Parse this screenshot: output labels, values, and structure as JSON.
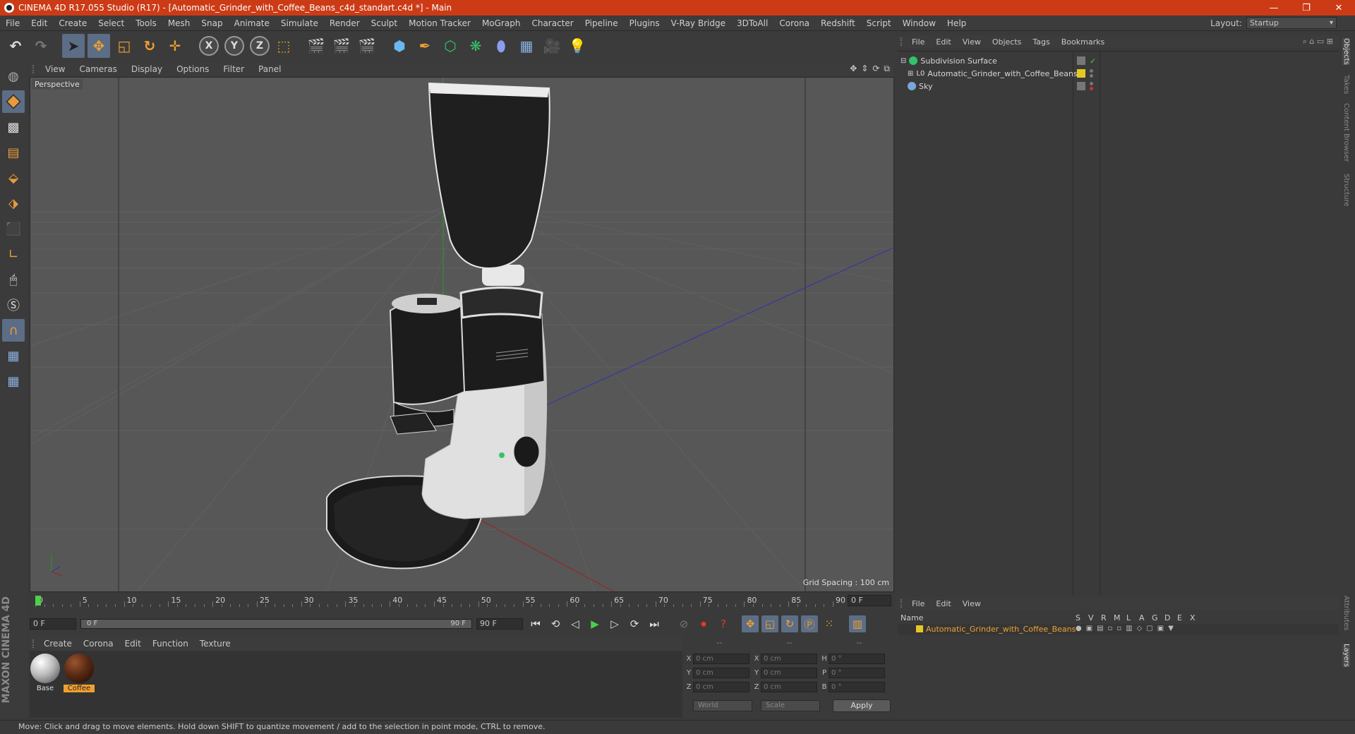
{
  "window": {
    "title": "CINEMA 4D R17.055 Studio (R17) - [Automatic_Grinder_with_Coffee_Beans_c4d_standart.c4d *] - Main",
    "controls": [
      "—",
      "❐",
      "✕"
    ]
  },
  "menubar": {
    "items": [
      "File",
      "Edit",
      "Create",
      "Select",
      "Tools",
      "Mesh",
      "Snap",
      "Animate",
      "Simulate",
      "Render",
      "Sculpt",
      "Motion Tracker",
      "MoGraph",
      "Character",
      "Pipeline",
      "Plugins",
      "V-Ray Bridge",
      "3DToAll",
      "Corona",
      "Redshift",
      "Script",
      "Window",
      "Help"
    ],
    "layout_label": "Layout:",
    "layout_value": "Startup"
  },
  "toolbar": {
    "axis_x": "X",
    "axis_y": "Y",
    "axis_z": "Z"
  },
  "viewport": {
    "menu": [
      "View",
      "Cameras",
      "Display",
      "Options",
      "Filter",
      "Panel"
    ],
    "label": "Perspective",
    "grid_spacing": "Grid Spacing : 100 cm"
  },
  "timeline": {
    "ticks": [
      "0",
      "5",
      "10",
      "15",
      "20",
      "25",
      "30",
      "35",
      "40",
      "45",
      "50",
      "55",
      "60",
      "65",
      "70",
      "75",
      "80",
      "85",
      "90"
    ],
    "current_frame": "0 F",
    "start_field": "0 F",
    "range_start": "0 F",
    "range_end": "90 F",
    "end_field": "90 F"
  },
  "material_manager": {
    "menu": [
      "Create",
      "Corona",
      "Edit",
      "Function",
      "Texture"
    ],
    "materials": [
      {
        "name": "Base",
        "selected": false
      },
      {
        "name": "Coffee",
        "selected": true
      }
    ]
  },
  "coordinates": {
    "headers": [
      "--",
      "--",
      "--"
    ],
    "rows": [
      {
        "a1": "X",
        "v1": "0 cm",
        "a2": "X",
        "v2": "0 cm",
        "a3": "H",
        "v3": "0 °"
      },
      {
        "a1": "Y",
        "v1": "0 cm",
        "a2": "Y",
        "v2": "0 cm",
        "a3": "P",
        "v3": "0 °"
      },
      {
        "a1": "Z",
        "v1": "0 cm",
        "a2": "Z",
        "v2": "0 cm",
        "a3": "B",
        "v3": "0 °"
      }
    ],
    "space": "World",
    "mode": "Scale",
    "apply": "Apply"
  },
  "object_manager": {
    "menu": [
      "File",
      "Edit",
      "View",
      "Objects",
      "Tags",
      "Bookmarks"
    ],
    "objects": [
      {
        "name": "Subdivision Surface",
        "icon_color": "#33c36a"
      },
      {
        "name": "Automatic_Grinder_with_Coffee_Beans",
        "icon_color": "#cfcfcf"
      },
      {
        "name": "Sky",
        "icon_color": "#7aa7d8"
      }
    ]
  },
  "layer_manager": {
    "menu": [
      "File",
      "Edit",
      "View"
    ],
    "headers": [
      "Name",
      "S",
      "V",
      "R",
      "M",
      "L",
      "A",
      "G",
      "D",
      "E",
      "X"
    ],
    "layers": [
      {
        "name": "Automatic_Grinder_with_Coffee_Beans",
        "color": "#e8c820"
      }
    ]
  },
  "side_tabs": [
    "Objects",
    "Takes",
    "Content Browser",
    "Structure"
  ],
  "side_tabs_lower": [
    "Attributes",
    "Layers"
  ],
  "brand": "MAXON CINEMA 4D",
  "statusbar": "Move: Click and drag to move elements. Hold down SHIFT to quantize movement / add to the selection in point mode, CTRL to remove.",
  "colors": {
    "titlebar": "#cc3b16",
    "accent_orange": "#f0a030",
    "active_tool": "#5c6d86",
    "play_green": "#4ad14a"
  }
}
